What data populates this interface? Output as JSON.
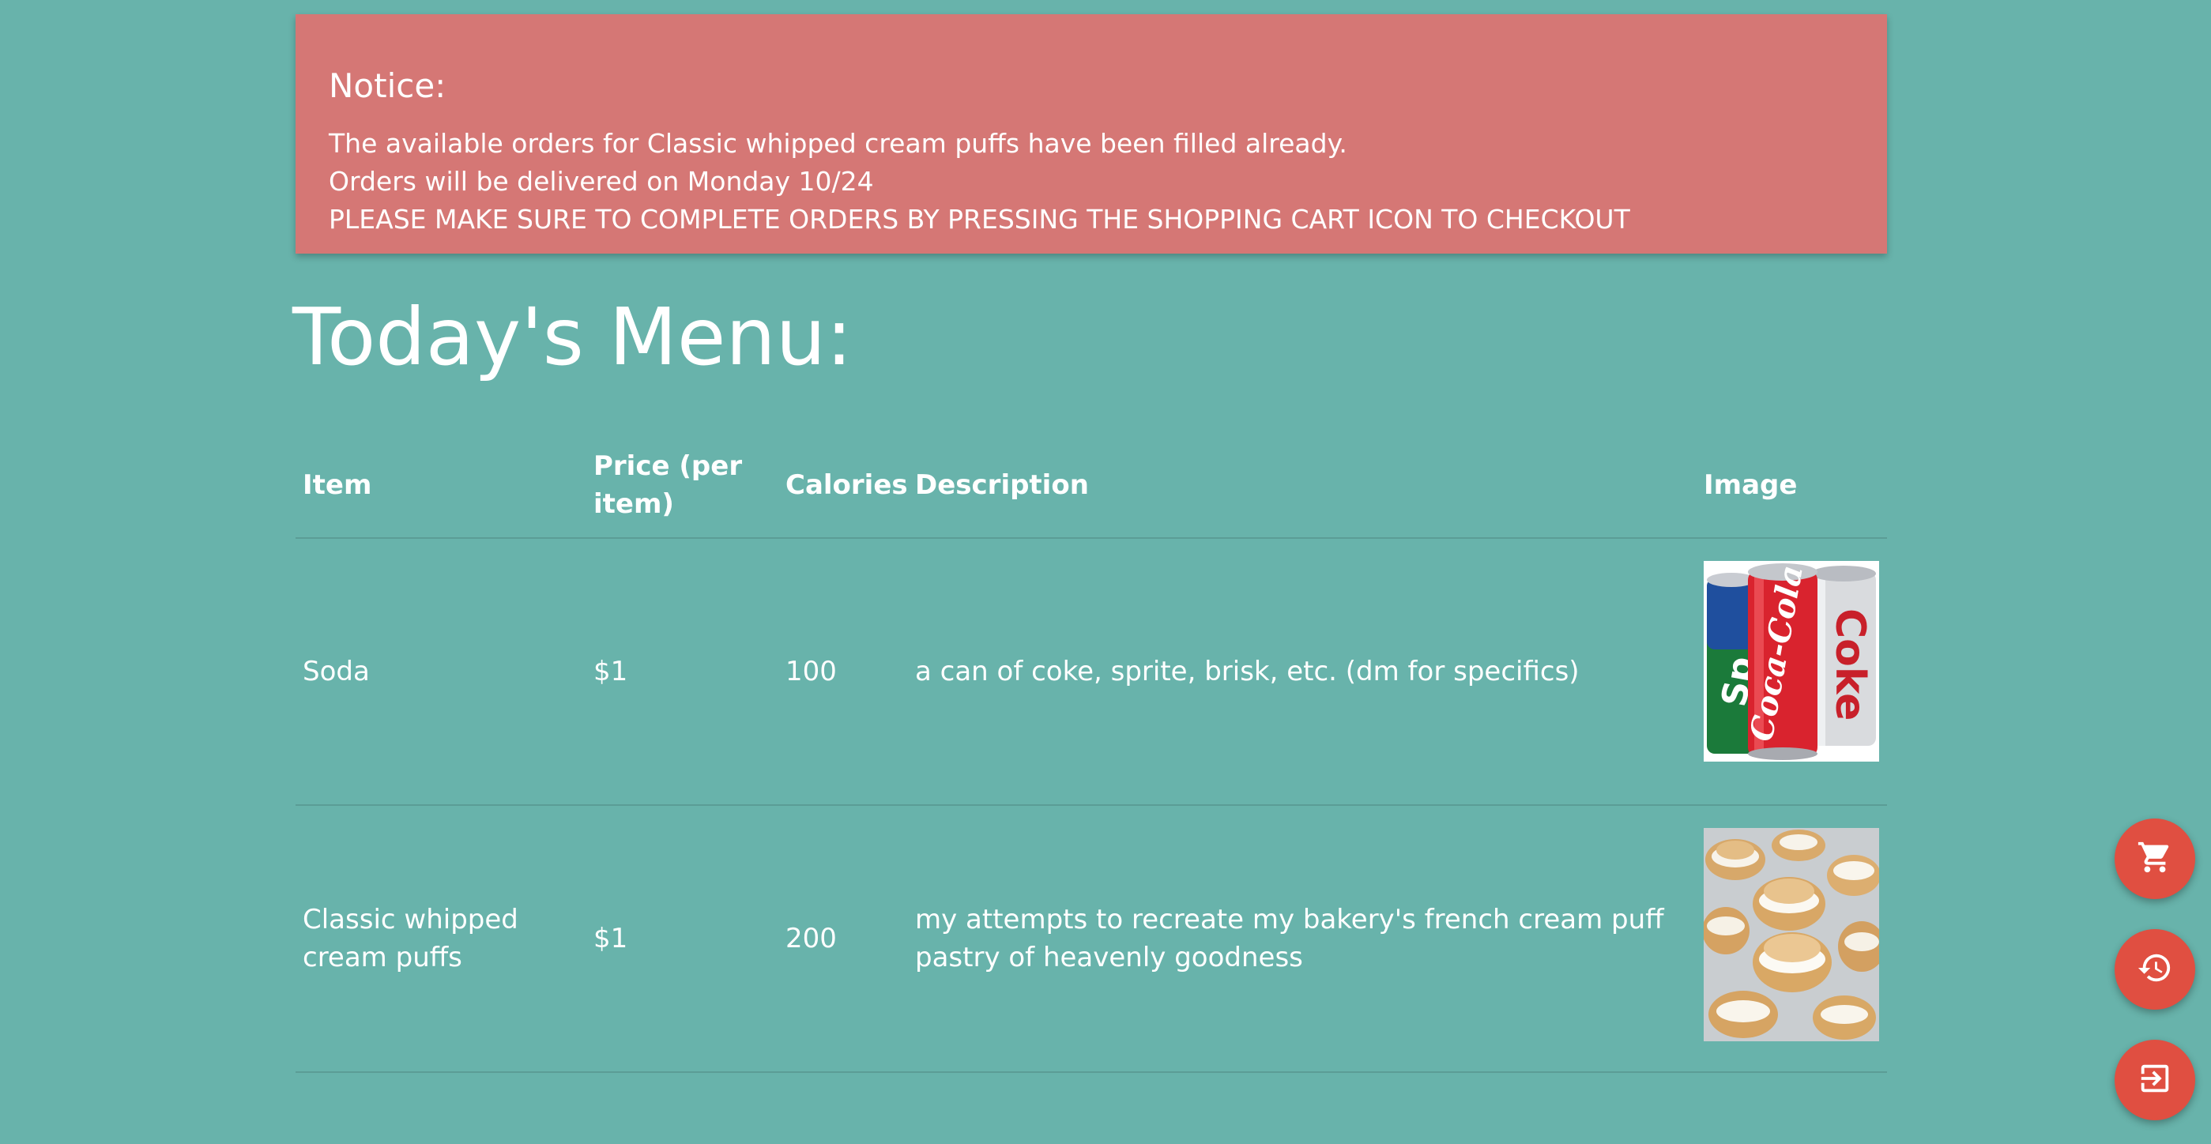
{
  "notice": {
    "title": "Notice:",
    "lines": [
      "The available orders for Classic whipped cream puffs have been filled already.",
      "Orders will be delivered on Monday 10/24",
      "PLEASE MAKE SURE TO COMPLETE ORDERS BY PRESSING THE SHOPPING CART ICON TO CHECKOUT"
    ],
    "background": "#d57775"
  },
  "menu": {
    "title": "Today's Menu:",
    "columns": {
      "item": "Item",
      "price": "Price (per item)",
      "calories": "Calories",
      "description": "Description",
      "image": "Image"
    },
    "rows": [
      {
        "item": "Soda",
        "price": "$1",
        "calories": "100",
        "description": "a can of coke, sprite, brisk, etc. (dm for specifics)",
        "image": "soda-cans-image"
      },
      {
        "item": "Classic whipped cream puffs",
        "price": "$1",
        "calories": "200",
        "description": "my attempts to recreate my bakery's french cream puff pastry of heavenly goodness",
        "image": "cream-puffs-image"
      }
    ]
  },
  "actions": {
    "cart_icon": "shopping-cart-icon",
    "history_icon": "history-icon",
    "logout_icon": "logout-icon",
    "button_color": "#e04f41"
  },
  "theme": {
    "background": "#68b3ab",
    "text": "#ffffff"
  }
}
